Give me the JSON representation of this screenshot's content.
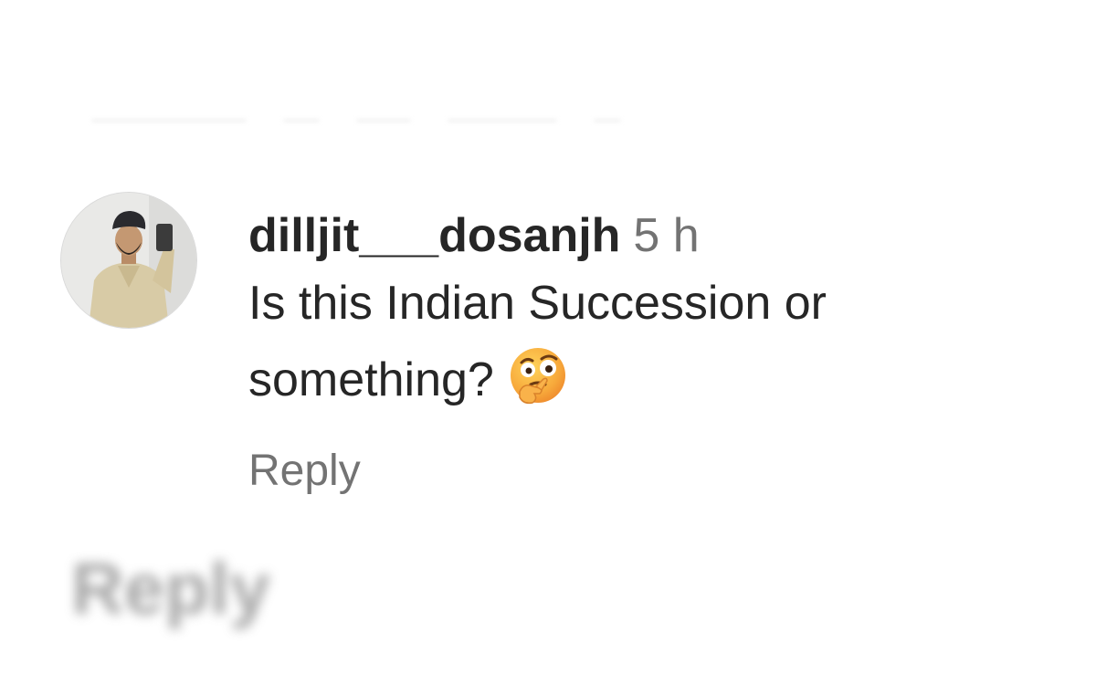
{
  "comment": {
    "username": "dilljit___dosanjh",
    "timestamp": "5 h",
    "text": "Is this Indian Succession or something?",
    "emoji_icon": "face-with-raised-eyebrow-thinking-emoji",
    "reply_label": "Reply",
    "avatar_icon": "user-avatar-photo"
  },
  "background_reply": {
    "label": "Reply"
  },
  "colors": {
    "text": "#262626",
    "secondary": "#737373",
    "emoji": "#f6a623"
  }
}
